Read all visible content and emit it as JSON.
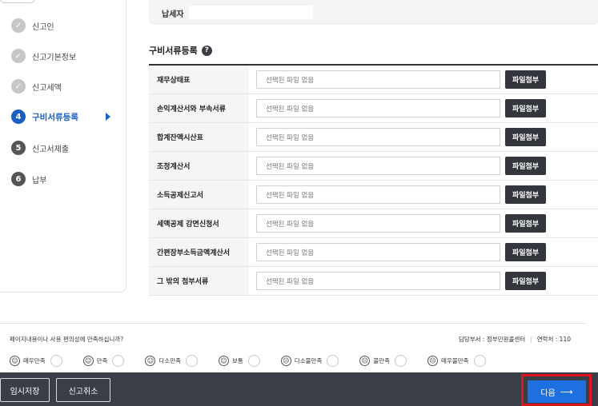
{
  "steps": [
    {
      "label": "신고인",
      "state": "done",
      "badge": "✓"
    },
    {
      "label": "신고기본정보",
      "state": "done",
      "badge": "✓"
    },
    {
      "label": "신고세액",
      "state": "done",
      "badge": "✓"
    },
    {
      "label": "구비서류등록",
      "state": "active",
      "badge": "4"
    },
    {
      "label": "신고서제출",
      "state": "todo",
      "badge": "5"
    },
    {
      "label": "납부",
      "state": "todo",
      "badge": "6"
    }
  ],
  "payer": {
    "label": "납세자",
    "value": ""
  },
  "section": {
    "title": "구비서류등록",
    "help": "?"
  },
  "documents": [
    {
      "label": "재무상태표",
      "file": "선택된 파일 없음",
      "button": "파일첨부"
    },
    {
      "label": "손익계산서와 부속서류",
      "file": "선택된 파일 없음",
      "button": "파일첨부"
    },
    {
      "label": "합계잔액시산표",
      "file": "선택된 파일 없음",
      "button": "파일첨부"
    },
    {
      "label": "조정계산서",
      "file": "선택된 파일 없음",
      "button": "파일첨부"
    },
    {
      "label": "소득공제신고서",
      "file": "선택된 파일 없음",
      "button": "파일첨부"
    },
    {
      "label": "세액공제 감면신청서",
      "file": "선택된 파일 없음",
      "button": "파일첨부"
    },
    {
      "label": "간편장부소득금액계산서",
      "file": "선택된 파일 없음",
      "button": "파일첨부"
    },
    {
      "label": "그 밖의 첨부서류",
      "file": "선택된 파일 없음",
      "button": "파일첨부"
    }
  ],
  "survey": {
    "question": "페이지내용이나 사용 편의성에 만족하십니까?",
    "department": "담당부서 : 정부민원콜센터",
    "contact": "연락처 : 110",
    "options": [
      {
        "label": "매우만족",
        "face": "☺"
      },
      {
        "label": "만족",
        "face": "☺"
      },
      {
        "label": "다소만족",
        "face": "☺"
      },
      {
        "label": "보통",
        "face": "☺"
      },
      {
        "label": "다소불만족",
        "face": "☹"
      },
      {
        "label": "불만족",
        "face": "☹"
      },
      {
        "label": "매우불만족",
        "face": "☹"
      }
    ]
  },
  "bottom_bar": {
    "save_label": "임시저장",
    "cancel_label": "신고취소",
    "next_label": "다음",
    "next_arrow": "⟶"
  },
  "colors": {
    "accent": "#1a5fc4",
    "next_button": "#1e6fe0",
    "highlight": "#e0141e",
    "bar": "#3a3e47"
  }
}
